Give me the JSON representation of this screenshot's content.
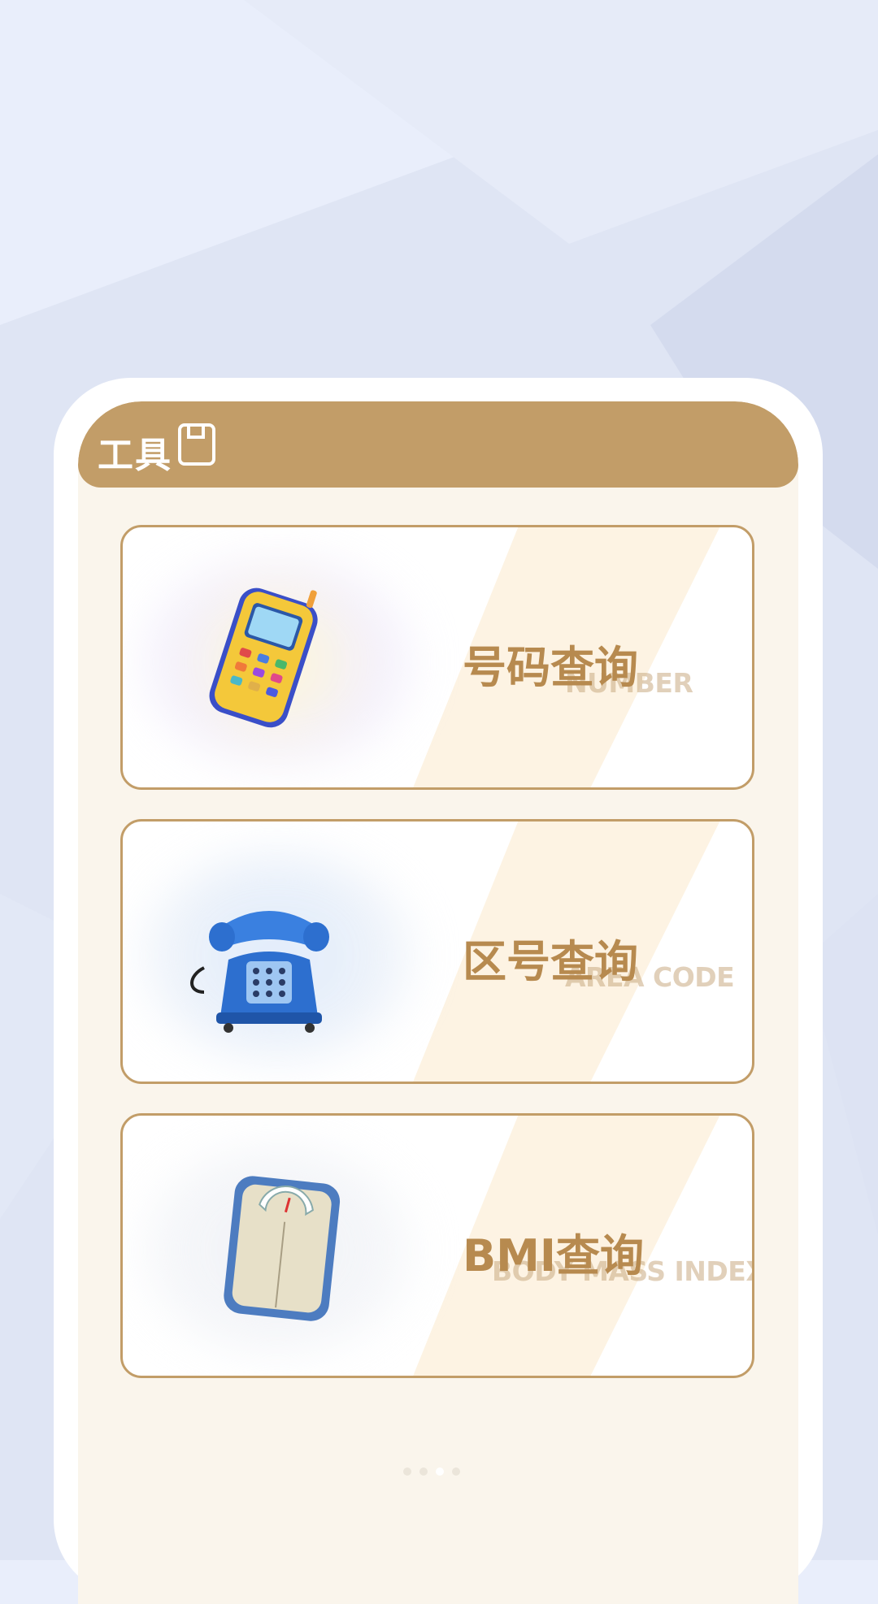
{
  "header": {
    "title": "工具",
    "icon": "bookmark-icon"
  },
  "tools": [
    {
      "title": "号码查询",
      "subtitle": "NUMBER",
      "icon": "mobile-phone-icon"
    },
    {
      "title": "区号查询",
      "subtitle": "AREA CODE",
      "icon": "telephone-icon"
    },
    {
      "title": "BMI查询",
      "subtitle": "BODY MASS INDEX",
      "icon": "scale-icon"
    }
  ],
  "pagination": {
    "count": 4,
    "active": 2
  },
  "colors": {
    "accent": "#c29d68",
    "title": "#b78a4f",
    "background": "#e9eefb",
    "screen": "#faf5ec"
  }
}
